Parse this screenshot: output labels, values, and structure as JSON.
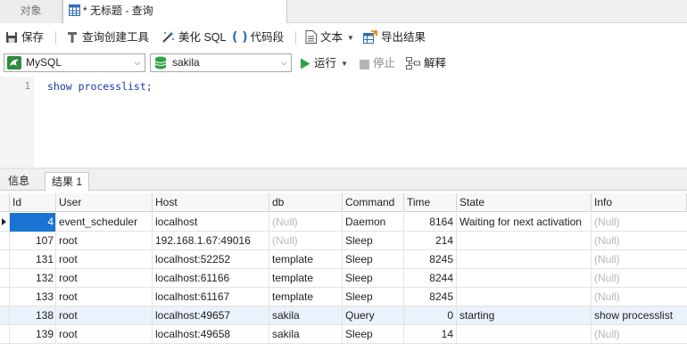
{
  "tabs": {
    "objects_label": "对象",
    "query_label": "* 无标题 - 查询"
  },
  "toolbar": {
    "save_label": "保存",
    "query_builder_label": "查询创建工具",
    "beautify_label": "美化 SQL",
    "snippet_label": "代码段",
    "text_label": "文本",
    "export_label": "导出结果"
  },
  "toolbar2": {
    "connection_value": "MySQL",
    "database_value": "sakila",
    "run_label": "运行",
    "stop_label": "停止",
    "explain_label": "解释"
  },
  "editor": {
    "line_number": "1",
    "code": "show processlist;"
  },
  "result_tabs": {
    "info_label": "信息",
    "result_label": "结果 1"
  },
  "grid": {
    "columns": [
      "Id",
      "User",
      "Host",
      "db",
      "Command",
      "Time",
      "State",
      "Info"
    ],
    "rows": [
      {
        "id": "4",
        "user": "event_scheduler",
        "host": "localhost",
        "db": "(Null)",
        "command": "Daemon",
        "time": "8164",
        "state": "Waiting for next activation",
        "info": "(Null)"
      },
      {
        "id": "107",
        "user": "root",
        "host": "192.168.1.67:49016",
        "db": "(Null)",
        "command": "Sleep",
        "time": "214",
        "state": "",
        "info": "(Null)"
      },
      {
        "id": "131",
        "user": "root",
        "host": "localhost:52252",
        "db": "template",
        "command": "Sleep",
        "time": "8245",
        "state": "",
        "info": "(Null)"
      },
      {
        "id": "132",
        "user": "root",
        "host": "localhost:61166",
        "db": "template",
        "command": "Sleep",
        "time": "8244",
        "state": "",
        "info": "(Null)"
      },
      {
        "id": "133",
        "user": "root",
        "host": "localhost:61167",
        "db": "template",
        "command": "Sleep",
        "time": "8245",
        "state": "",
        "info": "(Null)"
      },
      {
        "id": "138",
        "user": "root",
        "host": "localhost:49657",
        "db": "sakila",
        "command": "Query",
        "time": "0",
        "state": "starting",
        "info": "show processlist"
      },
      {
        "id": "139",
        "user": "root",
        "host": "localhost:49658",
        "db": "sakila",
        "command": "Sleep",
        "time": "14",
        "state": "",
        "info": "(Null)"
      }
    ]
  },
  "colors": {
    "accent": "#1874d0",
    "null_text": "#b8b8b8",
    "run_green": "#2ea043",
    "sql_blue": "#1a3aa8"
  }
}
